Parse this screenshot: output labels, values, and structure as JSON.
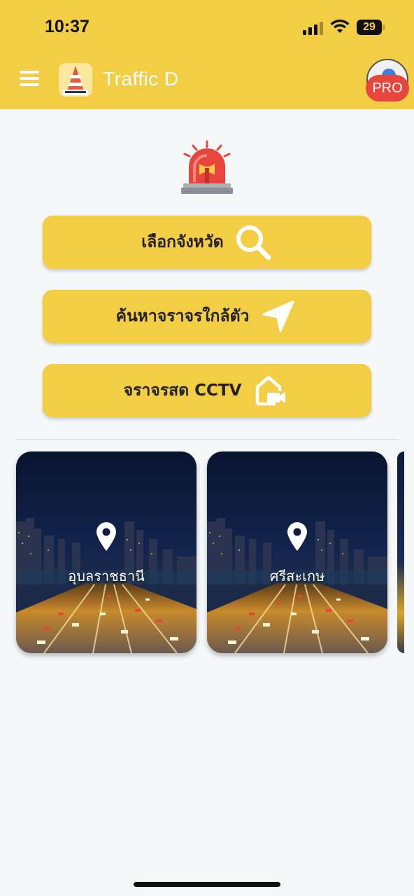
{
  "status_bar": {
    "time": "10:37",
    "battery": "29"
  },
  "header": {
    "title": "Traffic D",
    "pro_badge": "PRO"
  },
  "actions": [
    {
      "label": "เลือกจังหวัด",
      "icon": "search-icon"
    },
    {
      "label": "ค้นหาจราจรใกล้ตัว",
      "icon": "navigation-arrow-icon"
    },
    {
      "label": "จราจรสด CCTV",
      "icon": "cctv-camera-icon"
    }
  ],
  "provinces": [
    {
      "name": "อุบลราชธานี",
      "icon": "location-pin-icon"
    },
    {
      "name": "ศรีสะเกษ",
      "icon": "location-pin-icon"
    }
  ],
  "colors": {
    "accent": "#f3cd43",
    "background": "#f4f8f9",
    "badge": "#e8453c"
  }
}
